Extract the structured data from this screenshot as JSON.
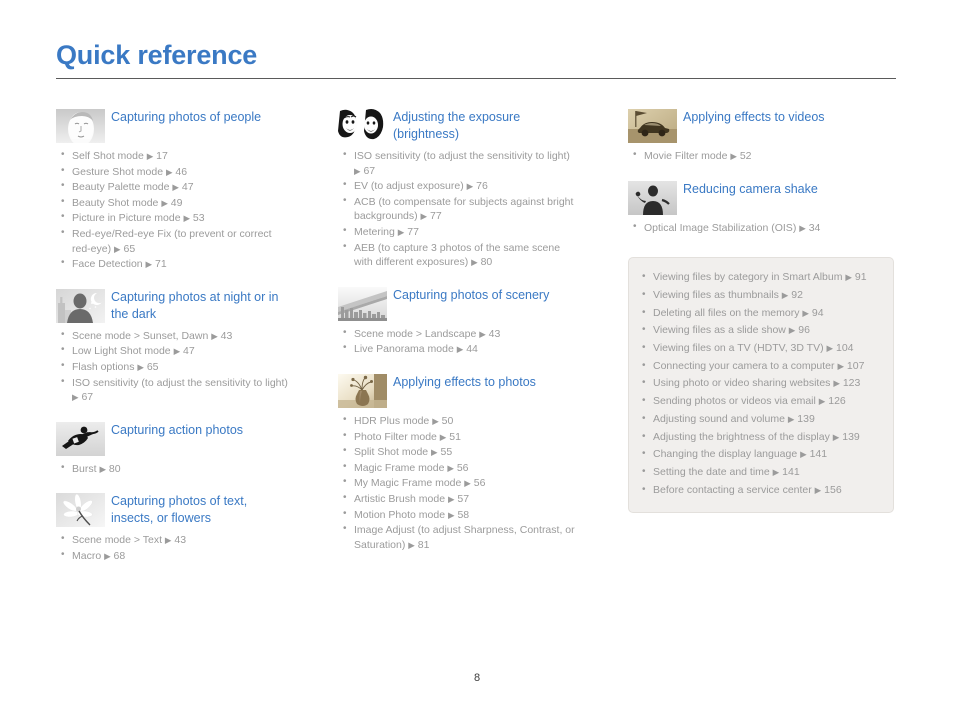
{
  "page": {
    "title": "Quick reference",
    "number": "8",
    "accent_color": "#3a79c4",
    "body_text_color": "#9b9b9b",
    "info_box_bg": "#f1efed"
  },
  "columns": [
    {
      "sections": [
        {
          "icon": "portrait-face-thumbnail",
          "title": "Capturing photos of people",
          "items": [
            {
              "text": "Self Shot mode",
              "page": "17"
            },
            {
              "text": "Gesture Shot mode",
              "page": "46"
            },
            {
              "text": "Beauty Palette mode",
              "page": "47"
            },
            {
              "text": "Beauty Shot mode",
              "page": "49"
            },
            {
              "text": "Picture in Picture mode",
              "page": "53"
            },
            {
              "text": "Red-eye/Red-eye Fix (to prevent or correct red-eye)",
              "page": "65"
            },
            {
              "text": "Face Detection",
              "page": "71"
            }
          ]
        },
        {
          "icon": "night-silhouette-thumbnail",
          "title": "Capturing photos at night or in the dark",
          "items": [
            {
              "text": "Scene mode > Sunset, Dawn",
              "page": "43"
            },
            {
              "text": "Low Light Shot mode",
              "page": "47"
            },
            {
              "text": "Flash options",
              "page": "65"
            },
            {
              "text": "ISO sensitivity (to adjust the sensitivity to light)",
              "page": "67"
            }
          ]
        },
        {
          "icon": "snowboarder-thumbnail",
          "title": "Capturing action photos",
          "items": [
            {
              "text": "Burst",
              "page": "80"
            }
          ]
        },
        {
          "icon": "flower-macro-thumbnail",
          "title": "Capturing photos of text, insects, or flowers",
          "items": [
            {
              "text": "Scene mode > Text",
              "page": "43"
            },
            {
              "text": "Macro",
              "page": "68"
            }
          ]
        }
      ]
    },
    {
      "sections": [
        {
          "icon": "two-faces-exposure-thumbnail",
          "title": "Adjusting the exposure (brightness)",
          "items": [
            {
              "text": "ISO sensitivity (to adjust the sensitivity to light)",
              "page": "67"
            },
            {
              "text": "EV (to adjust exposure)",
              "page": "76"
            },
            {
              "text": "ACB (to compensate for subjects against bright backgrounds)",
              "page": "77"
            },
            {
              "text": "Metering",
              "page": "77"
            },
            {
              "text": "AEB (to capture 3 photos of the same scene with different exposures)",
              "page": "80"
            }
          ]
        },
        {
          "icon": "bridge-landscape-thumbnail",
          "title": "Capturing photos of scenery",
          "items": [
            {
              "text": "Scene mode > Landscape",
              "page": "43"
            },
            {
              "text": "Live Panorama mode",
              "page": "44"
            }
          ]
        },
        {
          "icon": "vase-sepia-thumbnail",
          "title": "Applying effects to photos",
          "items": [
            {
              "text": "HDR Plus mode",
              "page": "50"
            },
            {
              "text": "Photo Filter mode",
              "page": "51"
            },
            {
              "text": "Split Shot mode",
              "page": "55"
            },
            {
              "text": "Magic Frame mode",
              "page": "56"
            },
            {
              "text": "My Magic Frame mode",
              "page": "56"
            },
            {
              "text": "Artistic Brush mode",
              "page": "57"
            },
            {
              "text": "Motion Photo mode",
              "page": "58"
            },
            {
              "text": "Image Adjust (to adjust Sharpness, Contrast, or Saturation)",
              "page": "81"
            }
          ]
        }
      ]
    },
    {
      "sections": [
        {
          "icon": "car-flag-sepia-thumbnail",
          "title": "Applying effects to videos",
          "items": [
            {
              "text": "Movie Filter mode",
              "page": "52"
            }
          ]
        },
        {
          "icon": "camera-shake-person-thumbnail",
          "title": "Reducing camera shake",
          "items": [
            {
              "text": "Optical Image Stabilization (OIS)",
              "page": "34"
            }
          ]
        }
      ],
      "info_box": {
        "items": [
          {
            "text": "Viewing files by category in Smart Album",
            "page": "91"
          },
          {
            "text": "Viewing files as thumbnails",
            "page": "92"
          },
          {
            "text": "Deleting all files on the memory",
            "page": "94"
          },
          {
            "text": "Viewing files as a slide show",
            "page": "96"
          },
          {
            "text": "Viewing files on a TV (HDTV, 3D TV)",
            "page": "104"
          },
          {
            "text": "Connecting your camera to a computer",
            "page": "107"
          },
          {
            "text": "Using photo or video sharing websites",
            "page": "123"
          },
          {
            "text": "Sending photos or videos via email",
            "page": "126"
          },
          {
            "text": "Adjusting sound and volume",
            "page": "139"
          },
          {
            "text": "Adjusting the brightness of the display",
            "page": "139"
          },
          {
            "text": "Changing the display language",
            "page": "141"
          },
          {
            "text": "Setting the date and time",
            "page": "141"
          },
          {
            "text": "Before contacting a service center",
            "page": "156"
          }
        ]
      }
    }
  ]
}
